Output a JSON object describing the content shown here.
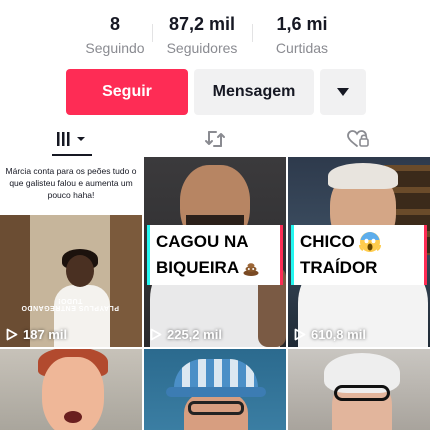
{
  "stats": [
    {
      "value": "8",
      "label": "Seguindo"
    },
    {
      "value": "87,2 mil",
      "label": "Seguidores"
    },
    {
      "value": "1,6 mi",
      "label": "Curtidas"
    }
  ],
  "actions": {
    "follow_label": "Seguir",
    "message_label": "Mensagem",
    "more_icon": "caret-down-icon"
  },
  "tabs": [
    {
      "icon": "videos-grid-icon",
      "active": true
    },
    {
      "icon": "repost-icon",
      "active": false
    },
    {
      "icon": "liked-icon",
      "active": false
    }
  ],
  "videos": [
    {
      "caption": "Márcia conta para os peões tudo o que galisteu falou e aumenta um pouco haha!",
      "overlay_text": "PLAYPLUS ENTREGANDO TUDO!",
      "views": "187 mil"
    },
    {
      "title_lines": [
        "CAGOU NA",
        "BIQUEIRA"
      ],
      "emoji": "poop-emoji",
      "views": "225,2 mil"
    },
    {
      "title_lines": [
        "CHICO",
        "TRAÍDOR"
      ],
      "emoji": "screaming-face-emoji",
      "views": "610,8 mil"
    },
    {},
    {},
    {}
  ],
  "colors": {
    "accent": "#fe2c55",
    "cyan": "#24f6f0",
    "text": "#161823",
    "muted": "#8a8b91",
    "button_bg": "#f1f1f2"
  }
}
